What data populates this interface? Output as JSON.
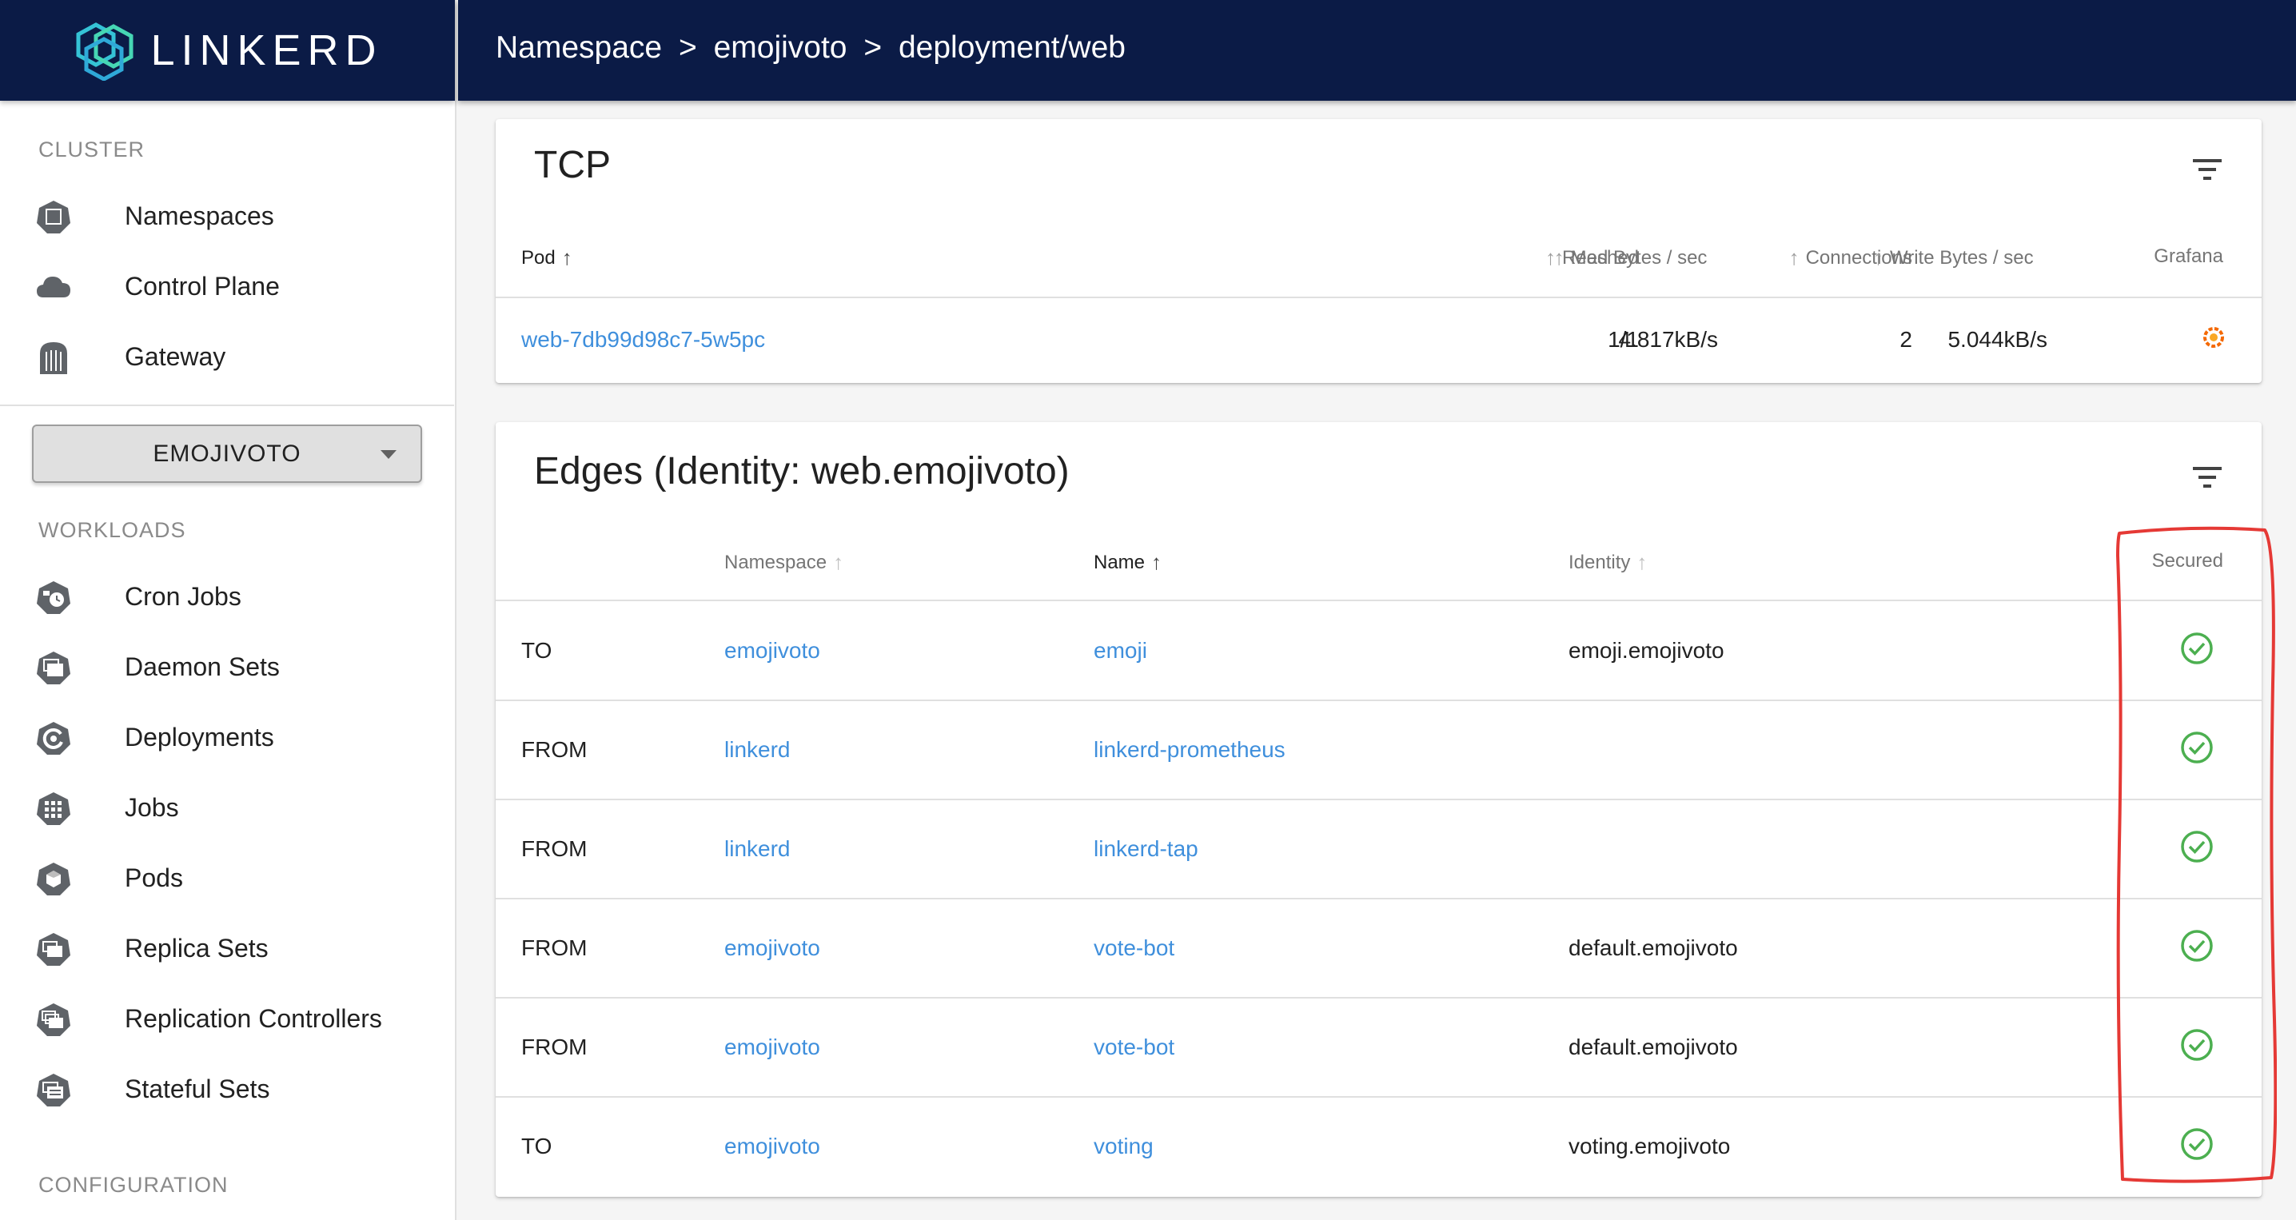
{
  "app": {
    "brand": "LINKERD"
  },
  "header": {
    "breadcrumb": [
      "Namespace",
      "emojivoto",
      "deployment/web"
    ],
    "separator": ">"
  },
  "sidebar": {
    "cluster_header": "CLUSTER",
    "cluster_items": [
      {
        "label": "Namespaces",
        "icon": "namespace-icon"
      },
      {
        "label": "Control Plane",
        "icon": "cloud-icon"
      },
      {
        "label": "Gateway",
        "icon": "gateway-icon"
      }
    ],
    "namespace_select": {
      "value": "EMOJIVOTO"
    },
    "workloads_header": "WORKLOADS",
    "workload_items": [
      {
        "label": "Cron Jobs",
        "icon": "cronjob-icon"
      },
      {
        "label": "Daemon Sets",
        "icon": "daemonset-icon"
      },
      {
        "label": "Deployments",
        "icon": "deployment-icon"
      },
      {
        "label": "Jobs",
        "icon": "job-icon"
      },
      {
        "label": "Pods",
        "icon": "pod-icon"
      },
      {
        "label": "Replica Sets",
        "icon": "replicaset-icon"
      },
      {
        "label": "Replication Controllers",
        "icon": "replicationcontroller-icon"
      },
      {
        "label": "Stateful Sets",
        "icon": "statefulset-icon"
      }
    ],
    "configuration_header": "CONFIGURATION"
  },
  "tcp": {
    "title": "TCP",
    "columns": {
      "pod": "Pod",
      "meshed": "Meshed",
      "connections": "Connections",
      "read": "Read Bytes / sec",
      "write": "Write Bytes / sec",
      "grafana": "Grafana"
    },
    "rows": [
      {
        "pod": "web-7db99d98c7-5w5pc",
        "meshed": "1/1",
        "connections": "2",
        "read": "4.817kB/s",
        "write": "5.044kB/s",
        "grafana": "grafana-icon"
      }
    ]
  },
  "edges": {
    "title": "Edges (Identity: web.emojivoto)",
    "columns": {
      "namespace": "Namespace",
      "name": "Name",
      "identity": "Identity",
      "secured": "Secured"
    },
    "rows": [
      {
        "direction": "TO",
        "namespace": "emojivoto",
        "name": "emoji",
        "identity": "emoji.emojivoto",
        "secured": true
      },
      {
        "direction": "FROM",
        "namespace": "linkerd",
        "name": "linkerd-prometheus",
        "identity": "",
        "secured": true
      },
      {
        "direction": "FROM",
        "namespace": "linkerd",
        "name": "linkerd-tap",
        "identity": "",
        "secured": true
      },
      {
        "direction": "FROM",
        "namespace": "emojivoto",
        "name": "vote-bot",
        "identity": "default.emojivoto",
        "secured": true
      },
      {
        "direction": "FROM",
        "namespace": "emojivoto",
        "name": "vote-bot",
        "identity": "default.emojivoto",
        "secured": true
      },
      {
        "direction": "TO",
        "namespace": "emojivoto",
        "name": "voting",
        "identity": "voting.emojivoto",
        "secured": true
      }
    ]
  },
  "colors": {
    "navy": "#0b1b46",
    "link": "#3f8fdc",
    "secured": "#4caf50",
    "annotation": "#e53935",
    "grafana": "#f46800"
  }
}
